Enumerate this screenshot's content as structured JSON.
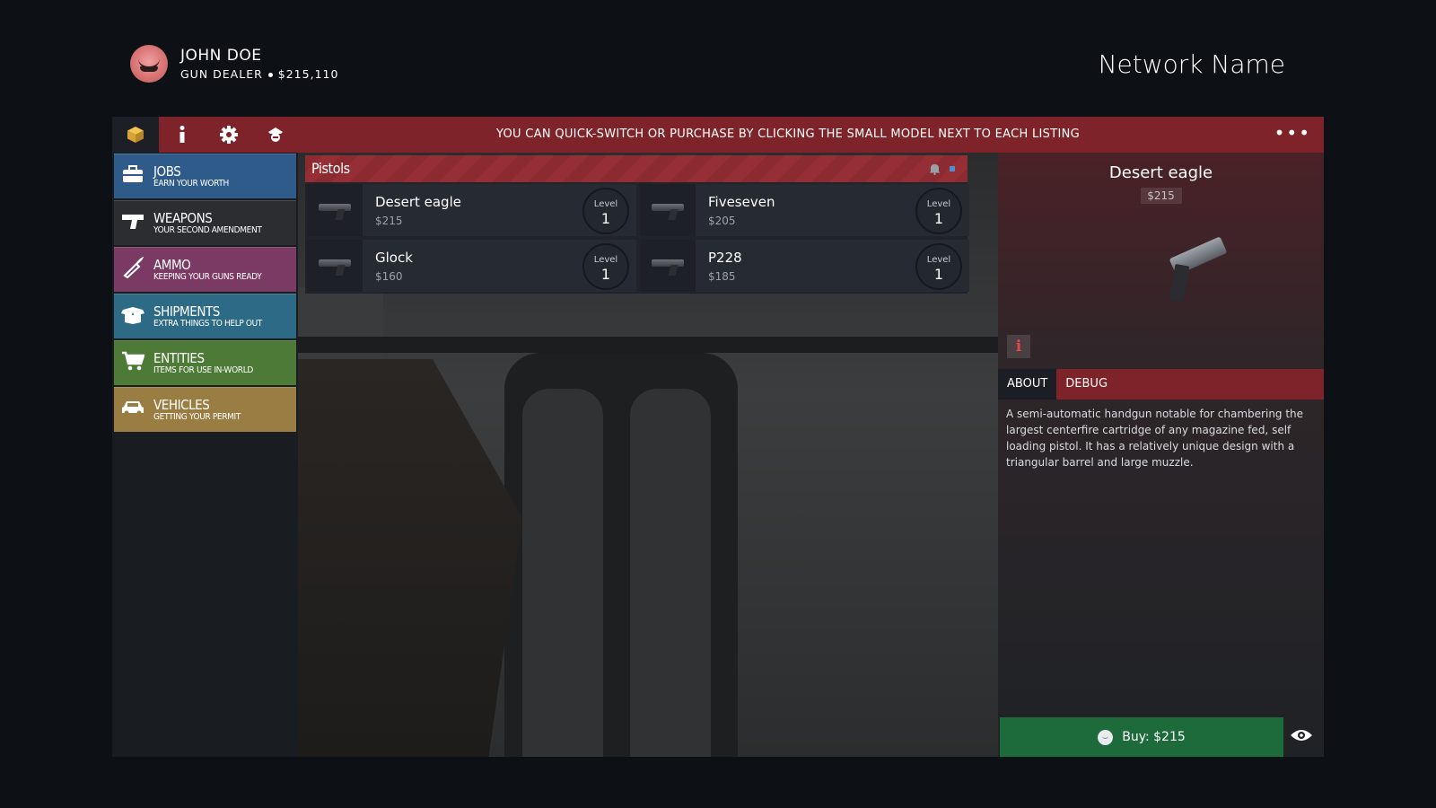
{
  "user": {
    "name": "JOHN DOE",
    "role": "GUN DEALER",
    "money": "$215,110"
  },
  "network": {
    "name": "Network Name"
  },
  "topbar": {
    "tabs": [
      {
        "icon": "box-icon",
        "active": true
      },
      {
        "icon": "info-icon"
      },
      {
        "icon": "gear-icon"
      },
      {
        "icon": "police-icon"
      }
    ],
    "notice": "YOU CAN QUICK-SWITCH OR PURCHASE BY CLICKING THE SMALL MODEL NEXT TO EACH LISTING",
    "more": "•••"
  },
  "sidebar": {
    "categories": [
      {
        "title": "JOBS",
        "subtitle": "EARN YOUR WORTH",
        "icon": "briefcase-icon",
        "color": "#2f5b8b"
      },
      {
        "title": "WEAPONS",
        "subtitle": "YOUR SECOND AMENDMENT",
        "icon": "pistol-icon",
        "color": "#2c2d31"
      },
      {
        "title": "AMMO",
        "subtitle": "KEEPING YOUR GUNS READY",
        "icon": "bullet-icon",
        "color": "#7a3a63"
      },
      {
        "title": "SHIPMENTS",
        "subtitle": "EXTRA THINGS TO HELP OUT",
        "icon": "open-box-icon",
        "color": "#2d6a86"
      },
      {
        "title": "ENTITIES",
        "subtitle": "ITEMS FOR USE IN-WORLD",
        "icon": "cart-icon",
        "color": "#4d7a36"
      },
      {
        "title": "VEHICLES",
        "subtitle": "GETTING YOUR PERMIT",
        "icon": "car-icon",
        "color": "#9a7d42"
      }
    ]
  },
  "listing": {
    "title": "Pistols",
    "level_label": "Level",
    "items": [
      {
        "name": "Desert eagle",
        "price": "$215",
        "level": "1"
      },
      {
        "name": "Fiveseven",
        "price": "$205",
        "level": "1"
      },
      {
        "name": "Glock",
        "price": "$160",
        "level": "1"
      },
      {
        "name": "P228",
        "price": "$185",
        "level": "1"
      }
    ]
  },
  "detail": {
    "title": "Desert eagle",
    "price": "$215",
    "info_glyph": "i",
    "tabs": [
      "ABOUT",
      "DEBUG"
    ],
    "description": "A semi-automatic handgun notable for chambering the largest centerfire cartridge of any magazine fed, self loading pistol. It has a relatively unique design with a triangular barrel and large muzzle.",
    "buy_label": "Buy: $215"
  },
  "colors": {
    "accent": "#7e2329",
    "buy": "#1d6b3b",
    "active_tab_icon": "#e6b43a"
  }
}
